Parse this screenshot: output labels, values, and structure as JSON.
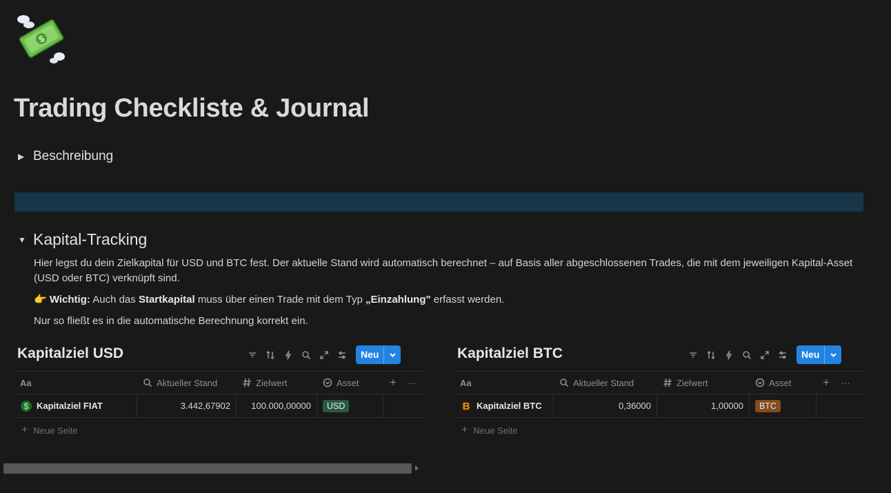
{
  "page": {
    "icon": "money-with-wings-icon",
    "title": "Trading Checkliste & Journal"
  },
  "toggles": {
    "description": "Beschreibung",
    "capital": "Kapital-Tracking"
  },
  "banner_color": "#173648",
  "text": {
    "p1": "Hier legst du dein Zielkapital für USD und BTC fest. Der aktuelle Stand wird automatisch berechnet – auf Basis aller abgeschlossenen Trades, die mit dem jeweiligen Kapital-Asset (USD oder BTC) verknüpft sind.",
    "p2_icon": "👉",
    "p2_bold1": "Wichtig:",
    "p2_t1": " Auch das ",
    "p2_bold2": "Startkapital",
    "p2_t2": " muss über einen Trade mit dem Typ ",
    "p2_bold3": "„Einzahlung\"",
    "p2_t3": " erfasst werden.",
    "p3": "Nur so fließt es in die automatische Berechnung korrekt ein."
  },
  "databases": {
    "usd": {
      "title": "Kapitalziel USD",
      "new_label": "Neu",
      "columns": {
        "name": "Aa",
        "current": "Aktueller Stand",
        "target": "Zielwert",
        "asset": "Asset"
      },
      "row": {
        "name": "Kapitalziel FIAT",
        "current": "3.442,67902",
        "target": "100.000,00000",
        "asset": "USD"
      },
      "new_page": "Neue Seite"
    },
    "btc": {
      "title": "Kapitalziel BTC",
      "new_label": "Neu",
      "columns": {
        "name": "Aa",
        "current": "Aktueller Stand",
        "target": "Zielwert",
        "asset": "Asset"
      },
      "row": {
        "name": "Kapitalziel BTC",
        "current": "0,36000",
        "target": "1,00000",
        "asset": "BTC"
      },
      "new_page": "Neue Seite"
    }
  },
  "colors": {
    "accent": "#2383e2",
    "tag_usd": "#2b593f",
    "tag_btc": "#854c1d",
    "background": "#191919"
  }
}
